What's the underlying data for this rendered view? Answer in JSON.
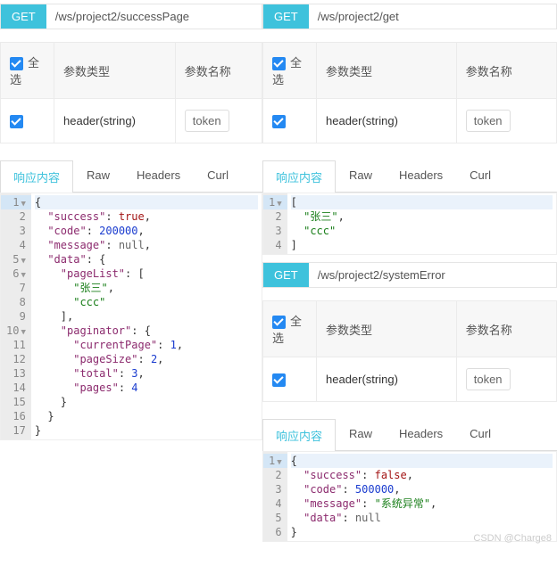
{
  "panels": [
    {
      "method": "GET",
      "url": "/ws/project2/successPage",
      "selectAll": "全选",
      "colType": "参数类型",
      "colName": "参数名称",
      "paramType": "header(string)",
      "paramName": "token",
      "tabs": {
        "content": "响应内容",
        "raw": "Raw",
        "headers": "Headers",
        "curl": "Curl"
      },
      "code": [
        "{",
        "  \"success\": true,",
        "  \"code\": 200000,",
        "  \"message\": null,",
        "  \"data\": {",
        "    \"pageList\": [",
        "      \"张三\",",
        "      \"ccc\"",
        "    ],",
        "    \"paginator\": {",
        "      \"currentPage\": 1,",
        "      \"pageSize\": 2,",
        "      \"total\": 3,",
        "      \"pages\": 4",
        "    }",
        "  }",
        "}"
      ]
    },
    {
      "method": "GET",
      "url": "/ws/project2/get",
      "selectAll": "全选",
      "colType": "参数类型",
      "colName": "参数名称",
      "paramType": "header(string)",
      "paramName": "token",
      "tabs": {
        "content": "响应内容",
        "raw": "Raw",
        "headers": "Headers",
        "curl": "Curl"
      },
      "code": [
        "[",
        "  \"张三\",",
        "  \"ccc\"",
        "]"
      ]
    },
    {
      "method": "GET",
      "url": "/ws/project2/systemError",
      "selectAll": "全选",
      "colType": "参数类型",
      "colName": "参数名称",
      "paramType": "header(string)",
      "paramName": "token",
      "tabs": {
        "content": "响应内容",
        "raw": "Raw",
        "headers": "Headers",
        "curl": "Curl"
      },
      "code": [
        "{",
        "  \"success\": false,",
        "  \"code\": 500000,",
        "  \"message\": \"系统异常\",",
        "  \"data\": null",
        "}"
      ]
    }
  ],
  "watermark": "CSDN @Charge8",
  "chart_data": {
    "type": "table",
    "responses": [
      {
        "endpoint": "/ws/project2/successPage",
        "success": true,
        "code": 200000,
        "message": null,
        "data": {
          "pageList": [
            "张三",
            "ccc"
          ],
          "paginator": {
            "currentPage": 1,
            "pageSize": 2,
            "total": 3,
            "pages": 4
          }
        }
      },
      {
        "endpoint": "/ws/project2/get",
        "body": [
          "张三",
          "ccc"
        ]
      },
      {
        "endpoint": "/ws/project2/systemError",
        "success": false,
        "code": 500000,
        "message": "系统异常",
        "data": null
      }
    ]
  }
}
